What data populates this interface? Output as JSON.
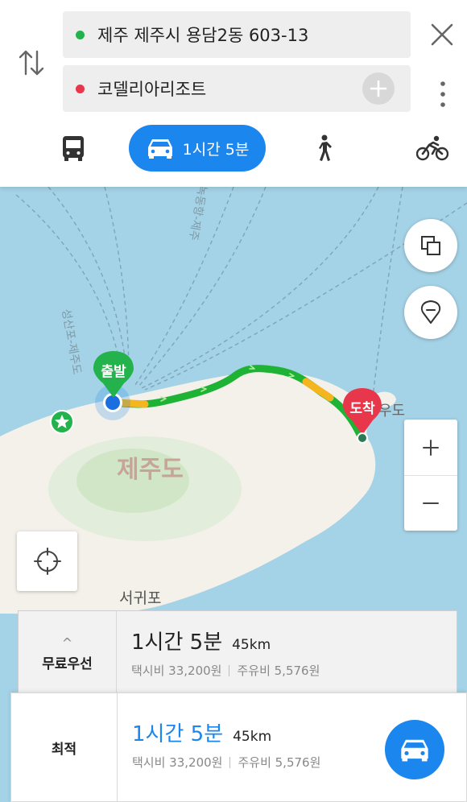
{
  "origin": {
    "text": "제주 제주시 용담2동 603-13",
    "dot_color": "#23b24b"
  },
  "destination": {
    "text": "코델리아리조트",
    "dot_color": "#e8364b"
  },
  "header_icons": {
    "swap": "swap-arrows-icon",
    "close": "close-icon",
    "more": "more-vertical-icon",
    "add": "plus-icon"
  },
  "modes": {
    "bus": {
      "icon": "bus-icon"
    },
    "car": {
      "icon": "car-icon",
      "label": "1시간 5분",
      "selected": true
    },
    "walk": {
      "icon": "walk-icon"
    },
    "bike": {
      "icon": "bike-icon"
    }
  },
  "map": {
    "labels": {
      "island": "제주도",
      "city": "서귀포",
      "udo": "우도",
      "ferry1": "성산포-제주도",
      "ferry2": "녹동항-제주"
    },
    "start_pin": "출발",
    "end_pin": "도착",
    "colors": {
      "sea": "#a4d2e6",
      "land": "#f3f1ea",
      "route": "#1fb336",
      "route_slow": "#f5b51f"
    }
  },
  "routes": [
    {
      "tag": "무료우선",
      "time": "1시간 5분",
      "distance": "45km",
      "taxi": "택시비 33,200원",
      "fuel": "주유비 5,576원"
    },
    {
      "tag": "최적",
      "time": "1시간 5분",
      "distance": "45km",
      "taxi": "택시비 33,200원",
      "fuel": "주유비 5,576원"
    }
  ],
  "accent": "#1a86ee"
}
